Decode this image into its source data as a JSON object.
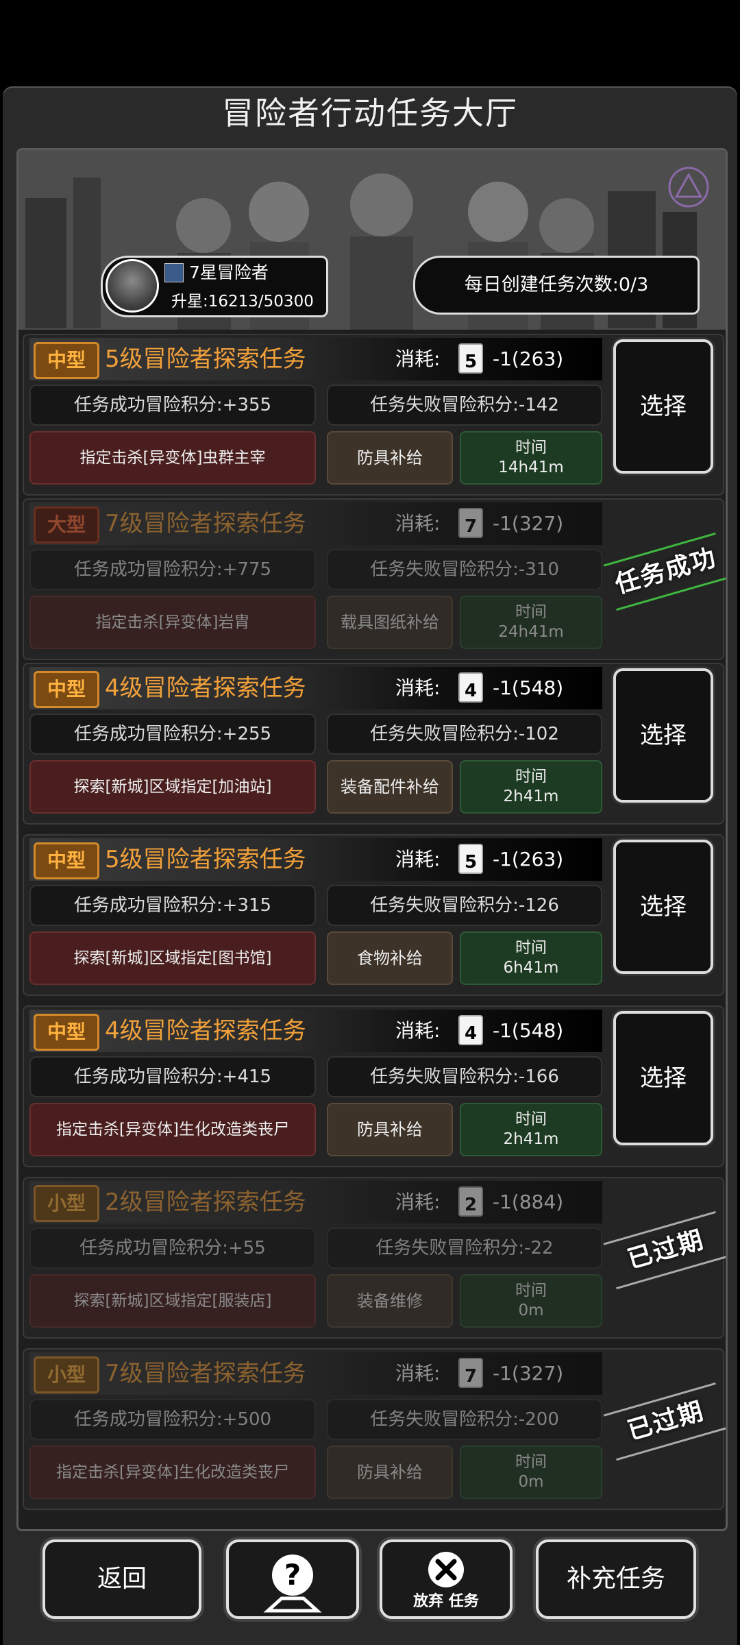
{
  "title": "冒险者行动任务大厅",
  "player": {
    "rank": "7星冒险者",
    "upgrade": "升星:16213/50300"
  },
  "daily": "每日创建任务次数:0/3",
  "missions": [
    {
      "size": "中型",
      "title": "5级冒险者探索任务",
      "cost_label": "消耗:",
      "cost_level": "5",
      "cost": "-1(263)",
      "success": "任务成功冒险积分:+355",
      "fail": "任务失败冒险积分:-142",
      "target": "指定击杀[异变体]虫群主宰",
      "supply": "防具补给",
      "time_label": "时间",
      "time": "14h41m",
      "action": "选择",
      "state": "active"
    },
    {
      "size": "大型",
      "title": "7级冒险者探索任务",
      "cost_label": "消耗:",
      "cost_level": "7",
      "cost": "-1(327)",
      "success": "任务成功冒险积分:+775",
      "fail": "任务失败冒险积分:-310",
      "target": "指定击杀[异变体]岩胄",
      "supply": "载具图纸补给",
      "time_label": "时间",
      "time": "24h41m",
      "action": "任务成功",
      "state": "success"
    },
    {
      "size": "中型",
      "title": "4级冒险者探索任务",
      "cost_label": "消耗:",
      "cost_level": "4",
      "cost": "-1(548)",
      "success": "任务成功冒险积分:+255",
      "fail": "任务失败冒险积分:-102",
      "target": "探索[新城]区域指定[加油站]",
      "supply": "装备配件补给",
      "time_label": "时间",
      "time": "2h41m",
      "action": "选择",
      "state": "active"
    },
    {
      "size": "中型",
      "title": "5级冒险者探索任务",
      "cost_label": "消耗:",
      "cost_level": "5",
      "cost": "-1(263)",
      "success": "任务成功冒险积分:+315",
      "fail": "任务失败冒险积分:-126",
      "target": "探索[新城]区域指定[图书馆]",
      "supply": "食物补给",
      "time_label": "时间",
      "time": "6h41m",
      "action": "选择",
      "state": "active"
    },
    {
      "size": "中型",
      "title": "4级冒险者探索任务",
      "cost_label": "消耗:",
      "cost_level": "4",
      "cost": "-1(548)",
      "success": "任务成功冒险积分:+415",
      "fail": "任务失败冒险积分:-166",
      "target": "指定击杀[异变体]生化改造类丧尸",
      "supply": "防具补给",
      "time_label": "时间",
      "time": "2h41m",
      "action": "选择",
      "state": "active"
    },
    {
      "size": "小型",
      "title": "2级冒险者探索任务",
      "cost_label": "消耗:",
      "cost_level": "2",
      "cost": "-1(884)",
      "success": "任务成功冒险积分:+55",
      "fail": "任务失败冒险积分:-22",
      "target": "探索[新城]区域指定[服装店]",
      "supply": "装备维修",
      "time_label": "时间",
      "time": "0m",
      "action": "已过期",
      "state": "expired"
    },
    {
      "size": "小型",
      "title": "7级冒险者探索任务",
      "cost_label": "消耗:",
      "cost_level": "7",
      "cost": "-1(327)",
      "success": "任务成功冒险积分:+500",
      "fail": "任务失败冒险积分:-200",
      "target": "指定击杀[异变体]生化改造类丧尸",
      "supply": "防具补给",
      "time_label": "时间",
      "time": "0m",
      "action": "已过期",
      "state": "expired"
    }
  ],
  "bottom": {
    "back": "返回",
    "help_icon": "question-icon",
    "abandon": "放弃 任务",
    "replenish": "补充任务"
  }
}
